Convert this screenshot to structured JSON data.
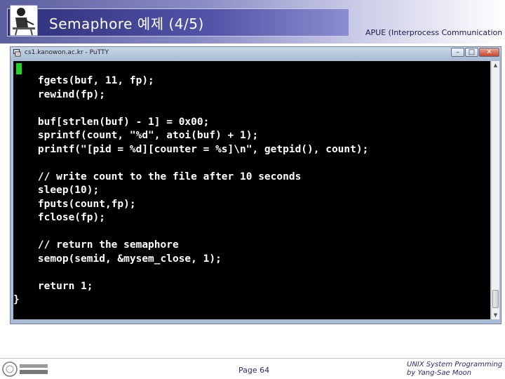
{
  "header": {
    "title": "Semaphore 예제 (4/5)",
    "subtitle": "APUE (Interprocess Communication"
  },
  "window": {
    "title": "cs1.kanowon.ac.kr - PuTTY",
    "controls": {
      "minimize": "–",
      "maximize": "□",
      "close": "✕"
    },
    "code_lines": [
      "    fgets(buf, 11, fp);",
      "    rewind(fp);",
      "",
      "    buf[strlen(buf) - 1] = 0x00;",
      "    sprintf(count, \"%d\", atoi(buf) + 1);",
      "    printf(\"[pid = %d][counter = %s]\\n\", getpid(), count);",
      "",
      "    // write count to the file after 10 seconds",
      "    sleep(10);",
      "    fputs(count,fp);",
      "    fclose(fp);",
      "",
      "    // return the semaphore",
      "    semop(semid, &mysem_close, 1);",
      "",
      "    return 1;",
      "}"
    ]
  },
  "footer": {
    "page": "Page 64",
    "course_line1": "UNIX System Programming",
    "course_line2": "by Yang-Sae Moon"
  }
}
